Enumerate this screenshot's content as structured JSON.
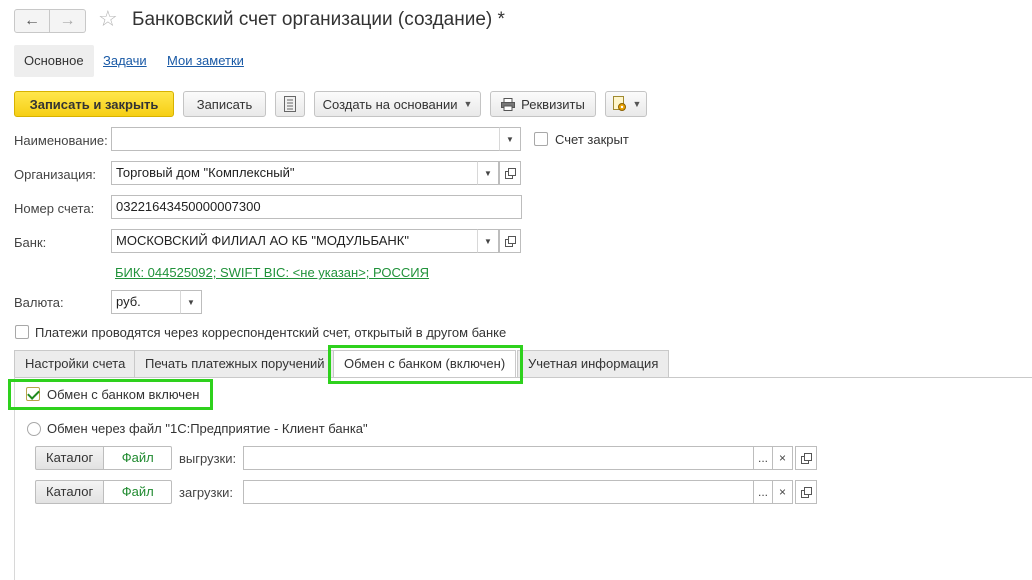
{
  "window": {
    "title": "Банковский счет организации (создание) *"
  },
  "nav": {
    "back_icon": "arrow-left-icon",
    "forward_icon": "arrow-right-icon",
    "favorite_icon": "star-icon"
  },
  "sections": {
    "main": "Основное",
    "tasks": "Задачи",
    "notes": "Мои заметки"
  },
  "toolbar": {
    "save_close": "Записать и закрыть",
    "save": "Записать",
    "create_based_on": "Создать на основании",
    "requisites": "Реквизиты"
  },
  "form": {
    "name_label": "Наименование:",
    "name_value": "",
    "account_closed_label": "Счет закрыт",
    "account_closed_checked": false,
    "organization_label": "Организация:",
    "organization_value": "Торговый дом \"Комплексный\"",
    "account_number_label": "Номер счета:",
    "account_number_value": "03221643450000007300",
    "bank_label": "Банк:",
    "bank_value": "МОСКОВСКИЙ ФИЛИАЛ АО КБ \"МОДУЛЬБАНК\"",
    "bank_info_link": "БИК: 044525092; SWIFT BIC: <не указан>; РОССИЯ",
    "currency_label": "Валюта:",
    "currency_value": "руб.",
    "corr_account_label": "Платежи проводятся через корреспондентский счет, открытый в другом банке",
    "corr_account_checked": false
  },
  "tabs": [
    {
      "label": "Настройки счета",
      "active": false
    },
    {
      "label": "Печать платежных поручений",
      "active": false
    },
    {
      "label": "Обмен с банком (включен)",
      "active": true
    },
    {
      "label": "Учетная информация",
      "active": false
    }
  ],
  "exchange": {
    "enabled_label": "Обмен с банком включен",
    "enabled_checked": true,
    "via_file_label": "Обмен через файл \"1С:Предприятие - Клиент банка\"",
    "via_file_selected": false,
    "export": {
      "toggle_catalog": "Каталог",
      "toggle_file": "Файл",
      "label": "выгрузки:",
      "value": ""
    },
    "import": {
      "toggle_catalog": "Каталог",
      "toggle_file": "Файл",
      "label": "загрузки:",
      "value": ""
    },
    "select_glyph": "...",
    "clear_glyph": "×"
  },
  "colors": {
    "primary_button": "#f6cf15",
    "highlight": "#2ed11d",
    "link_green": "#20923a",
    "link_blue": "#1a5aa6"
  }
}
